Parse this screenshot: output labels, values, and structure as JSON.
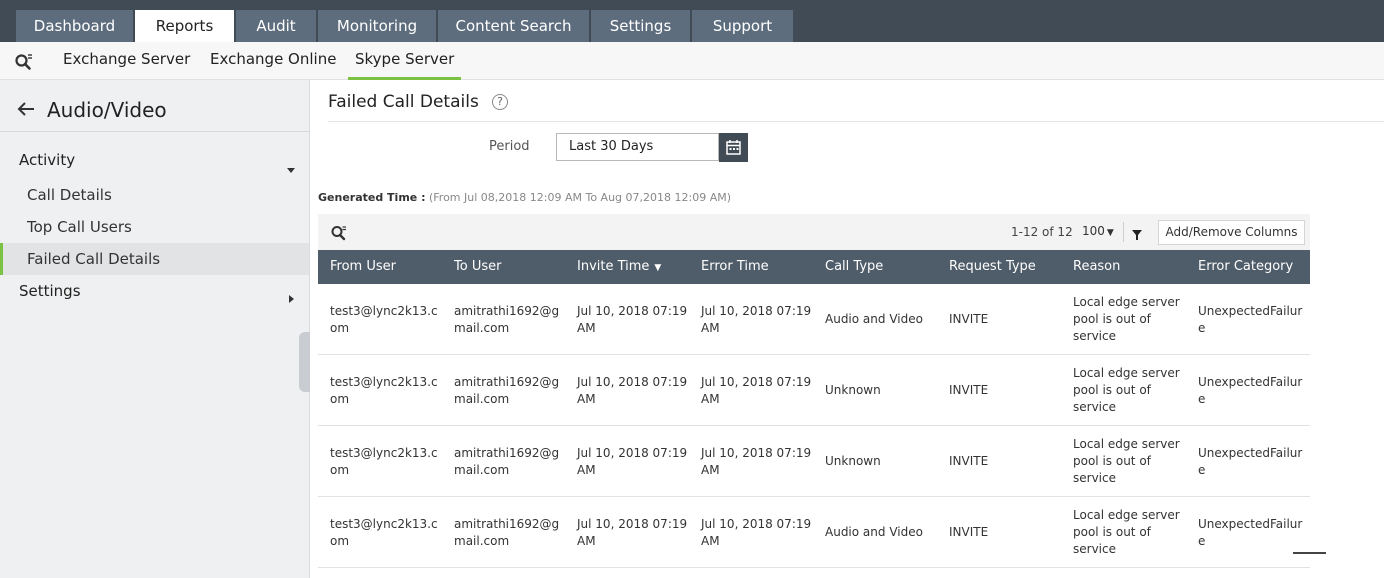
{
  "topnav": {
    "tabs": [
      "Dashboard",
      "Reports",
      "Audit",
      "Monitoring",
      "Content Search",
      "Settings",
      "Support"
    ],
    "active": "Reports"
  },
  "subnav": {
    "items": [
      "Exchange Server",
      "Exchange Online",
      "Skype Server"
    ],
    "active": "Skype Server"
  },
  "sidebar": {
    "title": "Audio/Video",
    "group_activity": "Activity",
    "items": [
      "Call Details",
      "Top Call Users",
      "Failed Call Details"
    ],
    "active_item": "Failed Call Details",
    "group_settings": "Settings"
  },
  "page": {
    "title": "Failed Call Details",
    "help": "?",
    "period_label": "Period",
    "period_value": "Last 30 Days",
    "generated_label": "Generated Time :",
    "generated_value": " (From Jul 08,2018 12:09 AM To Aug 07,2018 12:09 AM)"
  },
  "table": {
    "count": "1-12 of 12",
    "per_page": "100",
    "add_remove_columns": "Add/Remove Columns",
    "columns": [
      "From User",
      "To User",
      "Invite Time",
      "Error Time",
      "Call Type",
      "Request Type",
      "Reason",
      "Error Category"
    ],
    "sorted_column": "Invite Time",
    "rows": [
      {
        "from_user": [
          "test3@lync2k13.c",
          "om"
        ],
        "to_user": [
          "amitrathi1692@g",
          "mail.com"
        ],
        "invite_time": [
          "Jul 10, 2018 07:19",
          "AM"
        ],
        "error_time": [
          "Jul 10, 2018 07:19",
          "AM"
        ],
        "call_type": "Audio and Video",
        "request_type": "INVITE",
        "reason": [
          "Local edge server",
          "pool is out of",
          "service"
        ],
        "error_category": [
          "UnexpectedFailur",
          "e"
        ]
      },
      {
        "from_user": [
          "test3@lync2k13.c",
          "om"
        ],
        "to_user": [
          "amitrathi1692@g",
          "mail.com"
        ],
        "invite_time": [
          "Jul 10, 2018 07:19",
          "AM"
        ],
        "error_time": [
          "Jul 10, 2018 07:19",
          "AM"
        ],
        "call_type": "Unknown",
        "request_type": "INVITE",
        "reason": [
          "Local edge server",
          "pool is out of",
          "service"
        ],
        "error_category": [
          "UnexpectedFailur",
          "e"
        ]
      },
      {
        "from_user": [
          "test3@lync2k13.c",
          "om"
        ],
        "to_user": [
          "amitrathi1692@g",
          "mail.com"
        ],
        "invite_time": [
          "Jul 10, 2018 07:19",
          "AM"
        ],
        "error_time": [
          "Jul 10, 2018 07:19",
          "AM"
        ],
        "call_type": "Unknown",
        "request_type": "INVITE",
        "reason": [
          "Local edge server",
          "pool is out of",
          "service"
        ],
        "error_category": [
          "UnexpectedFailur",
          "e"
        ]
      },
      {
        "from_user": [
          "test3@lync2k13.c",
          "om"
        ],
        "to_user": [
          "amitrathi1692@g",
          "mail.com"
        ],
        "invite_time": [
          "Jul 10, 2018 07:19",
          "AM"
        ],
        "error_time": [
          "Jul 10, 2018 07:19",
          "AM"
        ],
        "call_type": "Audio and Video",
        "request_type": "INVITE",
        "reason": [
          "Local edge server",
          "pool is out of",
          "service"
        ],
        "error_category": [
          "UnexpectedFailur",
          "e"
        ]
      }
    ]
  },
  "colors": {
    "topbar": "#414b56",
    "tab": "#5d6d7e",
    "accent": "#7bc142",
    "table_header": "#4f5c69"
  }
}
